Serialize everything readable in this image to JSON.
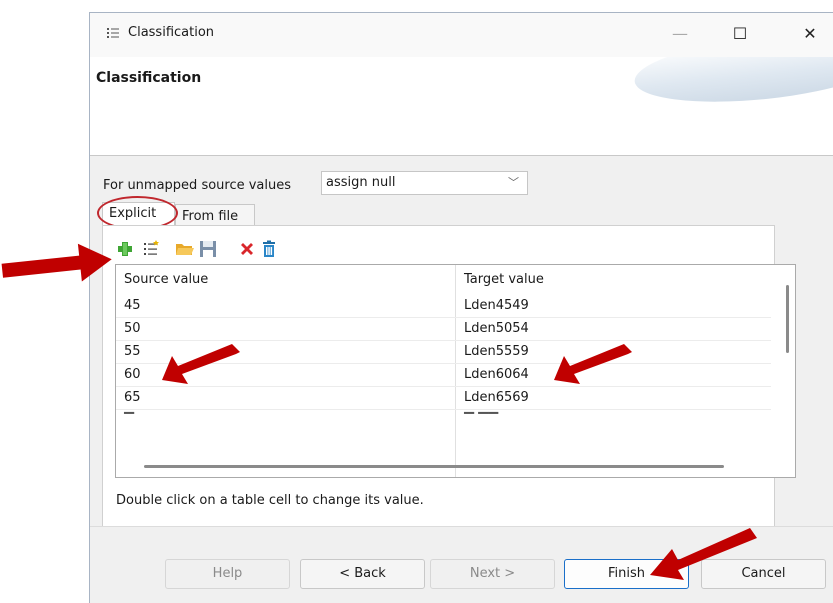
{
  "window": {
    "title": "Classification",
    "minimize_glyph": "—",
    "maximize_glyph": "☐",
    "close_glyph": "✕"
  },
  "banner": {
    "title": "Classification"
  },
  "unmapped": {
    "label": "For unmapped source values",
    "selected": "assign null"
  },
  "tabs": [
    {
      "label": "Explicit",
      "active": true
    },
    {
      "label": "From file",
      "active": false
    }
  ],
  "toolbar": {
    "icons": [
      "add-icon",
      "add-list-icon",
      "open-folder-icon",
      "save-icon",
      "delete-icon",
      "trash-icon"
    ]
  },
  "table": {
    "headers": [
      "Source value",
      "Target value"
    ],
    "rows": [
      [
        "45",
        "Lden4549"
      ],
      [
        "50",
        "Lden5054"
      ],
      [
        "55",
        "Lden5559"
      ],
      [
        "60",
        "Lden6064"
      ],
      [
        "65",
        "Lden6569"
      ]
    ]
  },
  "hint": "Double click on a table cell to change its value.",
  "buttons": {
    "help": "Help",
    "back": "< Back",
    "next": "Next >",
    "finish": "Finish",
    "cancel": "Cancel"
  },
  "colors": {
    "annotation": "#c00000",
    "accent": "#1a6fc9"
  }
}
